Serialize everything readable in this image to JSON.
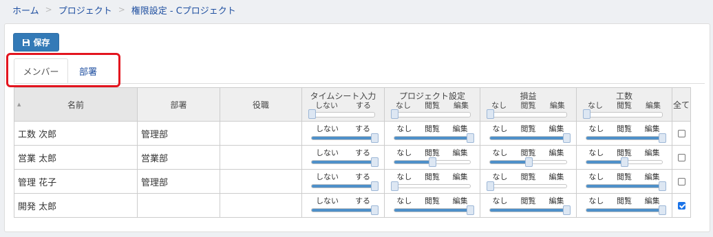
{
  "breadcrumb": {
    "home": "ホーム",
    "projects": "プロジェクト",
    "current": "権限設定 - Cプロジェクト",
    "sep": ">"
  },
  "toolbar": {
    "save_label": "保存"
  },
  "tabs": [
    {
      "label": "メンバー",
      "active": true
    },
    {
      "label": "部署",
      "active": false
    }
  ],
  "columns": {
    "name": "名前",
    "dept": "部署",
    "role": "役職",
    "timesheet": {
      "title": "タイムシート入力",
      "levels": [
        "しない",
        "する"
      ]
    },
    "project": {
      "title": "プロジェクト設定",
      "levels": [
        "なし",
        "閲覧",
        "編集"
      ]
    },
    "profit": {
      "title": "損益",
      "levels": [
        "なし",
        "閲覧",
        "編集"
      ]
    },
    "work": {
      "title": "工数",
      "levels": [
        "なし",
        "閲覧",
        "編集"
      ]
    },
    "all": "全て"
  },
  "rows": [
    {
      "name": "工数 次郎",
      "dept": "管理部",
      "role": "",
      "timesheet": 1,
      "project": 1,
      "profit": 1,
      "work": 1,
      "all": false
    },
    {
      "name": "営業 太郎",
      "dept": "営業部",
      "role": "",
      "timesheet": 1,
      "project": 0.5,
      "profit": 0.5,
      "work": 0.5,
      "all": false
    },
    {
      "name": "管理 花子",
      "dept": "管理部",
      "role": "",
      "timesheet": 1,
      "project": 0,
      "profit": 0,
      "work": 1,
      "all": false
    },
    {
      "name": "開発 太郎",
      "dept": "",
      "role": "",
      "timesheet": 1,
      "project": 1,
      "profit": 1,
      "work": 1,
      "all": true
    }
  ],
  "colors": {
    "accent": "#337ab7",
    "link": "#1f4fa0",
    "slider_fill": "#4e90c9",
    "highlight": "#e3141e"
  }
}
